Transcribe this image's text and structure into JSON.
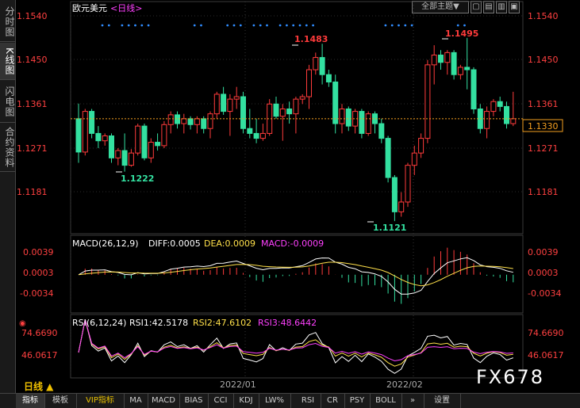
{
  "header": {
    "symbol": "欧元美元",
    "period": "<日线>",
    "theme_button": "全部主题▼"
  },
  "sidebar": [
    "分时图",
    "K线图",
    "闪电图",
    "合约资料"
  ],
  "price_axis": [
    "1.1540",
    "1.1450",
    "1.1361",
    "1.1271",
    "1.1181"
  ],
  "current_price": "1.1330",
  "annotations": {
    "high1": "1.1483",
    "high2": "1.1495",
    "low1": "1.1222",
    "low2": "1.1121"
  },
  "macd": {
    "title": "MACD(26,12,9)",
    "diff": "DIFF:0.0005",
    "dea": "DEA:0.0009",
    "macd": "MACD:-0.0009",
    "axis": [
      "0.0039",
      "0.0003",
      "-0.0034"
    ]
  },
  "rsi": {
    "title": "RSI(6,12,24)",
    "rsi1": "RSI1:42.5178",
    "rsi2": "RSI2:47.6102",
    "rsi3": "RSI3:48.6442",
    "axis": [
      "74.6690",
      "46.0617"
    ]
  },
  "time_labels": [
    "2022/01",
    "2022/02"
  ],
  "period_label": "日线 ▲",
  "watermark": "FX678",
  "bottom_tabs": [
    "指标",
    "模板",
    "VIP指标",
    "MA",
    "MACD",
    "BIAS",
    "CCI",
    "KDJ",
    "LW%",
    "RSI",
    "CR",
    "PSY",
    "BOLL",
    "»",
    "设置"
  ],
  "colors": {
    "up": "#ff3b3b",
    "down": "#33e0a0",
    "diff": "#ffffff",
    "dea": "#ffe04a",
    "macd_label": "#ff40ff",
    "rsi1": "#ffffff",
    "rsi2": "#ffe04a",
    "rsi3": "#ff40ff",
    "axis_text": "#ff4040"
  },
  "candles": [
    [
      1.133,
      1.1361,
      1.124,
      1.1262
    ],
    [
      1.1262,
      1.135,
      1.1255,
      1.1345
    ],
    [
      1.1345,
      1.135,
      1.129,
      1.13
    ],
    [
      1.13,
      1.1315,
      1.127,
      1.1285
    ],
    [
      1.1285,
      1.13,
      1.1275,
      1.1295
    ],
    [
      1.1295,
      1.13,
      1.124,
      1.125
    ],
    [
      1.125,
      1.127,
      1.1235,
      1.1265
    ],
    [
      1.1265,
      1.13,
      1.1222,
      1.1235
    ],
    [
      1.1235,
      1.1268,
      1.1232,
      1.126
    ],
    [
      1.126,
      1.132,
      1.1255,
      1.1315
    ],
    [
      1.1315,
      1.132,
      1.1245,
      1.125
    ],
    [
      1.125,
      1.129,
      1.124,
      1.1282
    ],
    [
      1.1282,
      1.13,
      1.1265,
      1.1275
    ],
    [
      1.1275,
      1.1325,
      1.127,
      1.1318
    ],
    [
      1.1318,
      1.1345,
      1.13,
      1.1338
    ],
    [
      1.1338,
      1.1345,
      1.131,
      1.132
    ],
    [
      1.132,
      1.134,
      1.13,
      1.133
    ],
    [
      1.133,
      1.1335,
      1.1308,
      1.1318
    ],
    [
      1.1318,
      1.1335,
      1.13,
      1.133
    ],
    [
      1.133,
      1.1335,
      1.13,
      1.131
    ],
    [
      1.131,
      1.1345,
      1.129,
      1.134
    ],
    [
      1.134,
      1.1385,
      1.133,
      1.138
    ],
    [
      1.138,
      1.1395,
      1.1338,
      1.1345
    ],
    [
      1.1345,
      1.138,
      1.1295,
      1.137
    ],
    [
      1.137,
      1.1395,
      1.135,
      1.1375
    ],
    [
      1.1375,
      1.1385,
      1.13,
      1.131
    ],
    [
      1.131,
      1.135,
      1.129,
      1.13
    ],
    [
      1.13,
      1.133,
      1.128,
      1.129
    ],
    [
      1.129,
      1.132,
      1.1285,
      1.13
    ],
    [
      1.13,
      1.137,
      1.1295,
      1.136
    ],
    [
      1.136,
      1.1375,
      1.133,
      1.1335
    ],
    [
      1.1335,
      1.136,
      1.1285,
      1.135
    ],
    [
      1.135,
      1.1365,
      1.132,
      1.134
    ],
    [
      1.134,
      1.1375,
      1.13,
      1.137
    ],
    [
      1.137,
      1.138,
      1.136,
      1.1375
    ],
    [
      1.1375,
      1.144,
      1.135,
      1.143
    ],
    [
      1.143,
      1.1465,
      1.142,
      1.1455
    ],
    [
      1.1455,
      1.1483,
      1.14,
      1.142
    ],
    [
      1.142,
      1.143,
      1.1395,
      1.1405
    ],
    [
      1.1405,
      1.142,
      1.13,
      1.132
    ],
    [
      1.132,
      1.136,
      1.13,
      1.135
    ],
    [
      1.135,
      1.1355,
      1.1305,
      1.1315
    ],
    [
      1.1315,
      1.135,
      1.13,
      1.1345
    ],
    [
      1.1345,
      1.135,
      1.129,
      1.13
    ],
    [
      1.13,
      1.1345,
      1.1295,
      1.134
    ],
    [
      1.134,
      1.1345,
      1.13,
      1.132
    ],
    [
      1.132,
      1.133,
      1.128,
      1.129
    ],
    [
      1.129,
      1.1295,
      1.12,
      1.121
    ],
    [
      1.121,
      1.1215,
      1.1121,
      1.114
    ],
    [
      1.114,
      1.118,
      1.113,
      1.116
    ],
    [
      1.116,
      1.124,
      1.115,
      1.1235
    ],
    [
      1.1235,
      1.1275,
      1.1215,
      1.126
    ],
    [
      1.126,
      1.13,
      1.125,
      1.129
    ],
    [
      1.129,
      1.145,
      1.128,
      1.144
    ],
    [
      1.144,
      1.148,
      1.14,
      1.146
    ],
    [
      1.146,
      1.147,
      1.143,
      1.1445
    ],
    [
      1.1445,
      1.147,
      1.142,
      1.1465
    ],
    [
      1.1465,
      1.147,
      1.141,
      1.142
    ],
    [
      1.142,
      1.144,
      1.141,
      1.1435
    ],
    [
      1.1435,
      1.1495,
      1.139,
      1.143
    ],
    [
      1.143,
      1.1435,
      1.134,
      1.135
    ],
    [
      1.135,
      1.136,
      1.13,
      1.131
    ],
    [
      1.131,
      1.1355,
      1.129,
      1.1345
    ],
    [
      1.1345,
      1.137,
      1.1335,
      1.1365
    ],
    [
      1.1365,
      1.1375,
      1.1345,
      1.1355
    ],
    [
      1.1355,
      1.1365,
      1.131,
      1.132
    ],
    [
      1.132,
      1.1385,
      1.1315,
      1.133
    ]
  ]
}
